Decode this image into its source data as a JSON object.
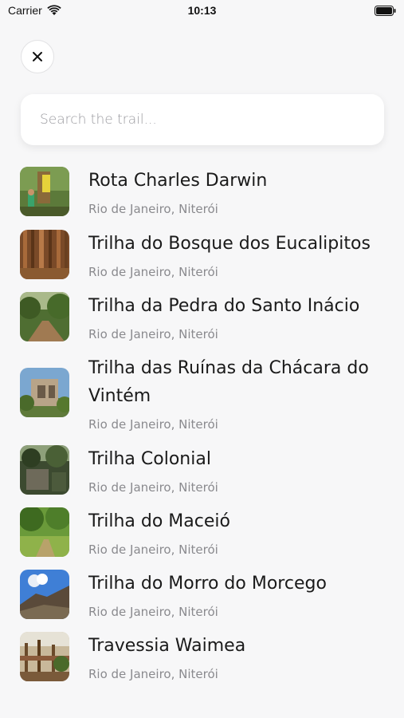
{
  "status_bar": {
    "carrier": "Carrier",
    "time": "10:13"
  },
  "search": {
    "placeholder": "Search the trail..."
  },
  "trails": [
    {
      "name": "Rota Charles Darwin",
      "location": "Rio de Janeiro, Niterói"
    },
    {
      "name": "Trilha do Bosque dos Eucalipitos",
      "location": "Rio de Janeiro, Niterói"
    },
    {
      "name": "Trilha da Pedra do Santo Inácio",
      "location": "Rio de Janeiro, Niterói"
    },
    {
      "name": "Trilha das Ruínas da Chácara do Vintém",
      "location": "Rio de Janeiro, Niterói"
    },
    {
      "name": "Trilha Colonial",
      "location": "Rio de Janeiro, Niterói"
    },
    {
      "name": "Trilha do Maceió",
      "location": "Rio de Janeiro, Niterói"
    },
    {
      "name": "Trilha do Morro do Morcego",
      "location": "Rio de Janeiro, Niterói"
    },
    {
      "name": "Travessia Waimea",
      "location": "Rio de Janeiro, Niterói"
    }
  ],
  "colors": {
    "background": "#f7f7f8",
    "title_text": "#1a1a1a",
    "subtitle_text": "#8a8a8e"
  }
}
